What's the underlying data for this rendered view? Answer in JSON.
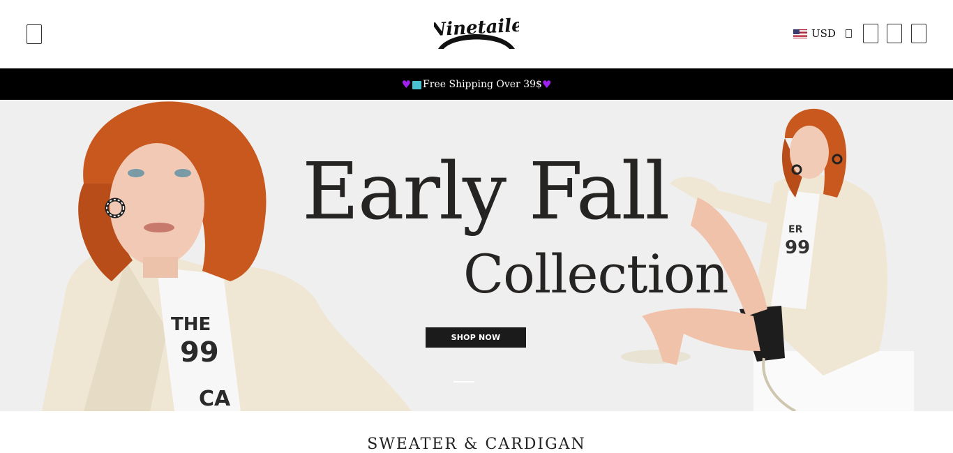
{
  "header": {
    "logo_text": "Ninetaile",
    "currency": "USD"
  },
  "announcement": {
    "text": "Free Shipping Over 39$"
  },
  "hero": {
    "title": "Early Fall",
    "subtitle": "Collection",
    "cta_label": "SHOP NOW"
  },
  "section": {
    "title": "SWEATER & CARDIGAN"
  },
  "colors": {
    "announcement_bg": "#000000",
    "heart": "#a020f0",
    "button_bg": "#1b1b1b"
  }
}
